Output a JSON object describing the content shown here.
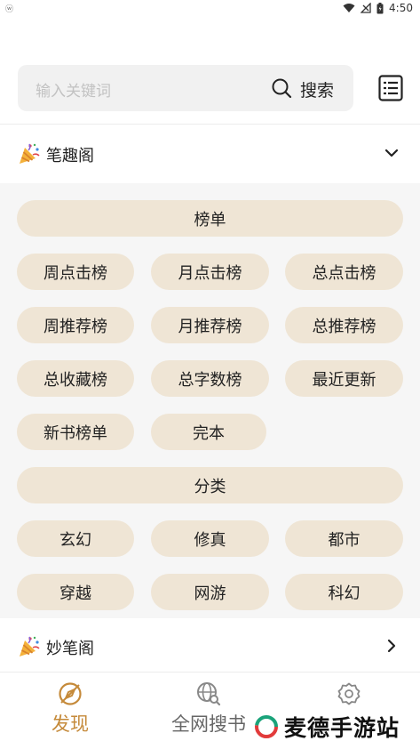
{
  "status_bar": {
    "time": "4:50",
    "left_text": "ⓦ"
  },
  "search": {
    "placeholder": "输入关键词",
    "button_label": "搜索"
  },
  "groups": [
    {
      "title": "笔趣阁",
      "expanded": true
    },
    {
      "title": "妙笔阁",
      "expanded": false
    }
  ],
  "rank_section": {
    "header": "榜单",
    "items": [
      "周点击榜",
      "月点击榜",
      "总点击榜",
      "周推荐榜",
      "月推荐榜",
      "总推荐榜",
      "总收藏榜",
      "总字数榜",
      "最近更新",
      "新书榜单",
      "完本"
    ]
  },
  "category_section": {
    "header": "分类",
    "items": [
      "玄幻",
      "修真",
      "都市",
      "穿越",
      "网游",
      "科幻"
    ]
  },
  "bottom_nav": [
    {
      "label": "发现",
      "icon": "compass-icon",
      "active": true
    },
    {
      "label": "全网搜书",
      "icon": "globe-search-icon",
      "active": false
    },
    {
      "label": "",
      "icon": "gear-icon",
      "active": false
    }
  ],
  "watermark": {
    "text": "麦德手游站"
  },
  "colors": {
    "accent": "#c58a3a",
    "pill_bg": "#efe5d5",
    "panel_bg": "#f6f6f6",
    "search_bg": "#f1f1f1"
  }
}
